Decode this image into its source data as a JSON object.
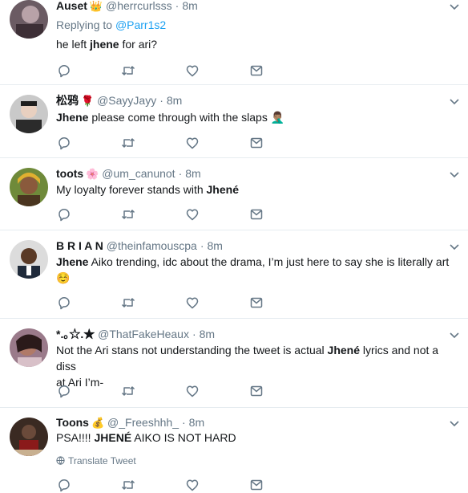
{
  "tweets": [
    {
      "name": "Auset",
      "badge": "👑",
      "handle": "@herrcurlsss",
      "time": "8m",
      "reply_prefix": "Replying to ",
      "reply_handle": "@Parr1s2",
      "text_pre": "he left ",
      "text_bold": "jhene",
      "text_post": " for ari?"
    },
    {
      "name": "松鸦",
      "badge": "🌹",
      "handle": "@SayyJayy",
      "time": "8m",
      "text_bold": "Jhene",
      "text_post": " please come through with the slaps 🤦🏽‍♂️"
    },
    {
      "name": "toots",
      "badge": "🌸",
      "handle": "@um_canunot",
      "time": "8m",
      "text_pre": "My loyalty forever stands with ",
      "text_bold": "Jhené"
    },
    {
      "name": "B R I A N",
      "handle": "@theinfamouscpa",
      "time": "8m",
      "text_bold": "Jhene",
      "text_post": " Aiko trending, idc about the drama, I’m just here to say she is literally art",
      "text_line2": "☺️"
    },
    {
      "name": "*.｡☆.★",
      "handle": "@ThatFakeHeaux",
      "time": "8m",
      "text_pre": "Not the Ari stans not understanding the tweet is actual ",
      "text_bold": "Jhené",
      "text_post": " lyrics and not a diss",
      "text_line2": "at Ari I’m-"
    },
    {
      "name": "Toons",
      "badge": "💰",
      "handle": "@_Freeshhh_",
      "time": "8m",
      "text_pre": "PSA!!!! ",
      "text_bold": "JHENÉ",
      "text_post": " AIKO IS NOT HARD",
      "translate": "Translate Tweet"
    }
  ],
  "colors": {
    "accent": "#1da1f2",
    "muted": "#657786",
    "text": "#14171a",
    "divider": "#e6ecf0"
  },
  "icons": [
    "reply-icon",
    "retweet-icon",
    "like-icon",
    "message-icon",
    "chevron-down-icon",
    "globe-icon"
  ]
}
